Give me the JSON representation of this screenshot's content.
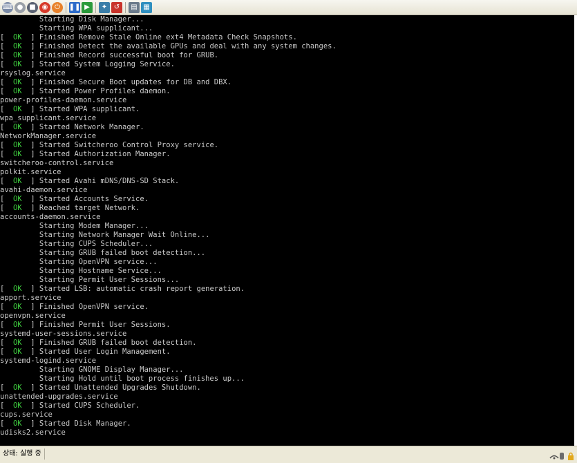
{
  "toolbar": {
    "buttons": [
      {
        "icon": "keyboard-icon",
        "glyph": "⌨",
        "color": "#7a8aa6"
      },
      {
        "icon": "power-icon",
        "glyph": "●",
        "color": "#9aa0a8"
      },
      {
        "icon": "stop-icon",
        "glyph": "■",
        "color": "#5a6272"
      },
      {
        "icon": "reset-icon",
        "glyph": "◉",
        "color": "#d73a2a"
      },
      {
        "icon": "shutdown-icon",
        "glyph": "⏻",
        "color": "#e8812a"
      },
      {
        "icon": "pause-icon",
        "glyph": "❚❚",
        "color": "#2d6cc9"
      },
      {
        "icon": "play-icon",
        "glyph": "▶",
        "color": "#2a9a3a"
      },
      {
        "icon": "snapshot-icon",
        "glyph": "✦",
        "color": "#3a7ea8"
      },
      {
        "icon": "revert-icon",
        "glyph": "↺",
        "color": "#c9342a"
      },
      {
        "icon": "snapshot-manager-icon",
        "glyph": "▤",
        "color": "#6a7a8a"
      },
      {
        "icon": "unity-icon",
        "glyph": "▦",
        "color": "#2f8fbf"
      }
    ]
  },
  "console": {
    "lines": [
      {
        "status": "",
        "text": "         Starting Disk Manager..."
      },
      {
        "status": "",
        "text": "         Starting WPA supplicant..."
      },
      {
        "status": "OK",
        "text": "Finished Remove Stale Online ext4 Metadata Check Snapshots."
      },
      {
        "status": "OK",
        "text": "Finished Detect the available GPUs and deal with any system changes."
      },
      {
        "status": "OK",
        "text": "Finished Record successful boot for GRUB."
      },
      {
        "status": "OK",
        "text": "Started System Logging Service."
      },
      {
        "status": "",
        "text": "rsyslog.service"
      },
      {
        "status": "OK",
        "text": "Finished Secure Boot updates for DB and DBX."
      },
      {
        "status": "OK",
        "text": "Started Power Profiles daemon."
      },
      {
        "status": "",
        "text": "power-profiles-daemon.service"
      },
      {
        "status": "OK",
        "text": "Started WPA supplicant."
      },
      {
        "status": "",
        "text": "wpa_supplicant.service"
      },
      {
        "status": "OK",
        "text": "Started Network Manager."
      },
      {
        "status": "",
        "text": "NetworkManager.service"
      },
      {
        "status": "OK",
        "text": "Started Switcheroo Control Proxy service."
      },
      {
        "status": "OK",
        "text": "Started Authorization Manager."
      },
      {
        "status": "",
        "text": "switcheroo-control.service"
      },
      {
        "status": "",
        "text": "polkit.service"
      },
      {
        "status": "OK",
        "text": "Started Avahi mDNS/DNS-SD Stack."
      },
      {
        "status": "",
        "text": "avahi-daemon.service"
      },
      {
        "status": "OK",
        "text": "Started Accounts Service."
      },
      {
        "status": "OK",
        "text": "Reached target Network."
      },
      {
        "status": "",
        "text": "accounts-daemon.service"
      },
      {
        "status": "",
        "text": "         Starting Modem Manager..."
      },
      {
        "status": "",
        "text": "         Starting Network Manager Wait Online..."
      },
      {
        "status": "",
        "text": "         Starting CUPS Scheduler..."
      },
      {
        "status": "",
        "text": "         Starting GRUB failed boot detection..."
      },
      {
        "status": "",
        "text": "         Starting OpenVPN service..."
      },
      {
        "status": "",
        "text": "         Starting Hostname Service..."
      },
      {
        "status": "",
        "text": "         Starting Permit User Sessions..."
      },
      {
        "status": "OK",
        "text": "Started LSB: automatic crash report generation."
      },
      {
        "status": "",
        "text": "apport.service"
      },
      {
        "status": "OK",
        "text": "Finished OpenVPN service."
      },
      {
        "status": "",
        "text": "openvpn.service"
      },
      {
        "status": "OK",
        "text": "Finished Permit User Sessions."
      },
      {
        "status": "",
        "text": "systemd-user-sessions.service"
      },
      {
        "status": "OK",
        "text": "Finished GRUB failed boot detection."
      },
      {
        "status": "OK",
        "text": "Started User Login Management."
      },
      {
        "status": "",
        "text": "systemd-logind.service"
      },
      {
        "status": "",
        "text": "         Starting GNOME Display Manager..."
      },
      {
        "status": "",
        "text": "         Starting Hold until boot process finishes up..."
      },
      {
        "status": "OK",
        "text": "Started Unattended Upgrades Shutdown."
      },
      {
        "status": "",
        "text": "unattended-upgrades.service"
      },
      {
        "status": "OK",
        "text": "Started CUPS Scheduler."
      },
      {
        "status": "",
        "text": "cups.service"
      },
      {
        "status": "OK",
        "text": "Started Disk Manager."
      },
      {
        "status": "",
        "text": "udisks2.service"
      }
    ]
  },
  "statusbar": {
    "text": "상태: 실행 중",
    "icons": [
      "network-icon",
      "usb-icon",
      "lock-icon"
    ]
  },
  "colors": {
    "ok": "#3ecb3e",
    "console_bg": "#000000",
    "console_fg": "#c9c9c9",
    "highlight": "#ffffff"
  }
}
